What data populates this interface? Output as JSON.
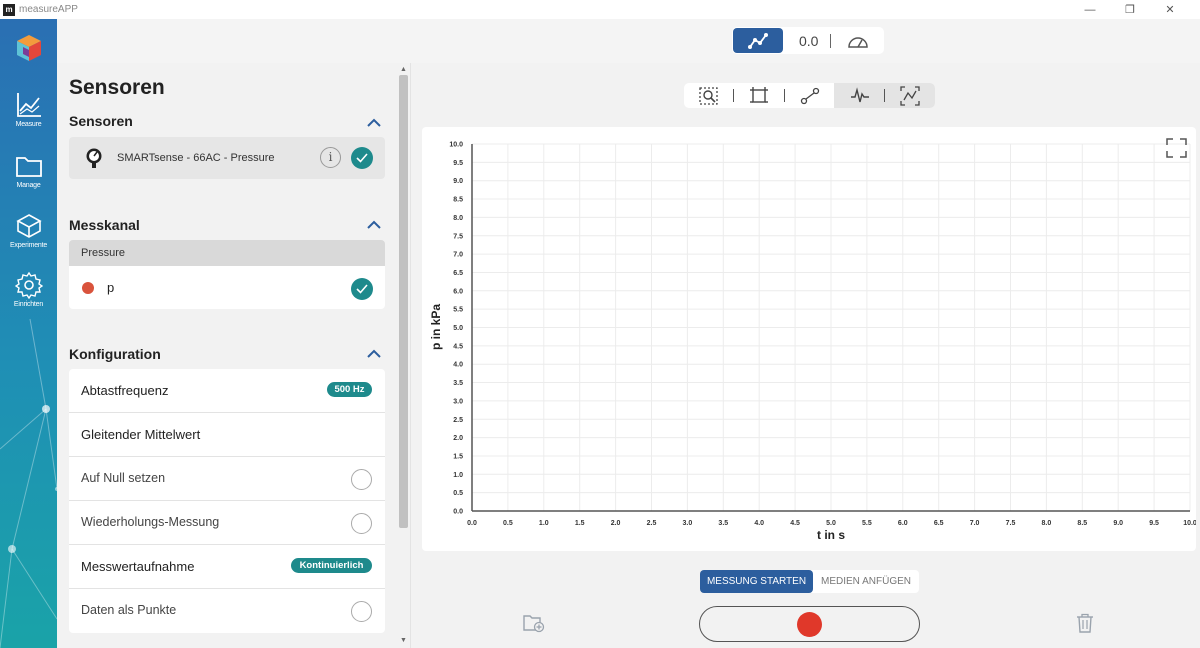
{
  "window": {
    "logo_letter": "m",
    "title": "measureAPP",
    "controls": [
      "—",
      "❐",
      "✕"
    ]
  },
  "nav": [
    {
      "label": "Measure",
      "icon": "chart-line-icon"
    },
    {
      "label": "Manage",
      "icon": "folder-icon"
    },
    {
      "label": "Experimente",
      "icon": "cube-icon"
    },
    {
      "label": "Einrichten",
      "icon": "gear-icon"
    }
  ],
  "topbar": {
    "mode_value": "0.0"
  },
  "panel": {
    "title": "Sensoren",
    "sensors": {
      "heading": "Sensoren",
      "sensor_name": "SMARTsense - 66AC - Pressure",
      "info_label": "i"
    },
    "channel": {
      "heading": "Messkanal",
      "group_label": "Pressure",
      "channel_label": "p",
      "channel_color": "#d9533c"
    },
    "config": {
      "heading": "Konfiguration",
      "rows": [
        {
          "label": "Abtastfrequenz",
          "badge": "500 Hz"
        },
        {
          "label": "Gleitender Mittelwert"
        },
        {
          "label": "Auf Null setzen"
        },
        {
          "label": "Wiederholungs-Messung"
        },
        {
          "label": "Messwertaufnahme",
          "badge": "Kontinuierlich"
        },
        {
          "label": "Daten als Punkte"
        }
      ]
    }
  },
  "chart_data": {
    "type": "line",
    "title": "",
    "xlabel": "t in s",
    "ylabel": "p in kPa",
    "xlim": [
      0,
      10
    ],
    "ylim": [
      0,
      10
    ],
    "x_ticks": [
      "0.0",
      "0.5",
      "1.0",
      "1.5",
      "2.0",
      "2.5",
      "3.0",
      "3.5",
      "4.0",
      "4.5",
      "5.0",
      "5.5",
      "6.0",
      "6.5",
      "7.0",
      "7.5",
      "8.0",
      "8.5",
      "9.0",
      "9.5",
      "10.0"
    ],
    "y_ticks": [
      "0.0",
      "0.5",
      "1.0",
      "1.5",
      "2.0",
      "2.5",
      "3.0",
      "3.5",
      "4.0",
      "4.5",
      "5.0",
      "5.5",
      "6.0",
      "6.5",
      "7.0",
      "7.5",
      "8.0",
      "8.5",
      "9.0",
      "9.5",
      "10.0"
    ],
    "grid": true,
    "series": []
  },
  "actions": {
    "start_label": "MESSUNG STARTEN",
    "media_label": "MEDIEN ANFÜGEN"
  },
  "colors": {
    "accent": "#2c5e9e",
    "teal": "#1e8a8c",
    "record": "#e0382a"
  }
}
